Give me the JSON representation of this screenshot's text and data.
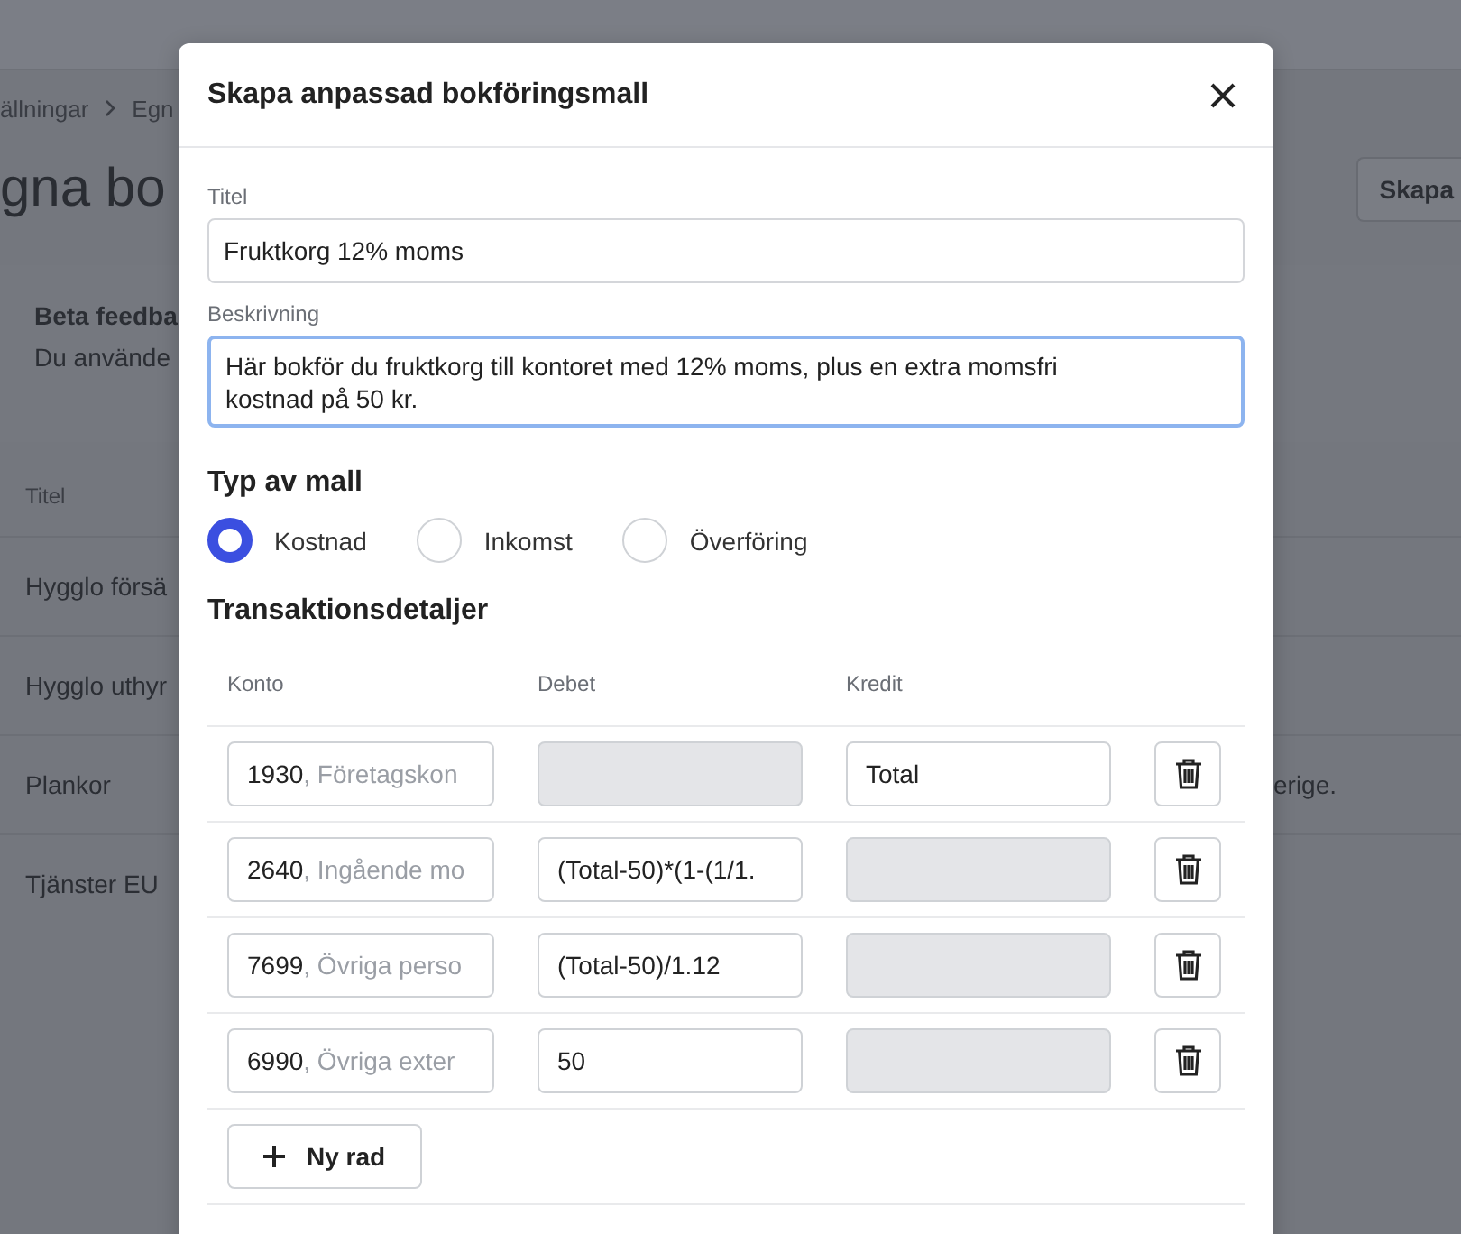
{
  "background_page": {
    "breadcrumb": [
      "ällningar",
      "Egn"
    ],
    "heading": "gna bo",
    "create_button": "Skapa",
    "beta_card": {
      "title": "Beta feedba",
      "text": "Du använde"
    },
    "table": {
      "columns": [
        "Titel"
      ],
      "rows": [
        {
          "cells": [
            "Hygglo försä"
          ]
        },
        {
          "cells": [
            "Hygglo uthyr"
          ]
        },
        {
          "cells": [
            "Plankor",
            "erige."
          ]
        },
        {
          "cells": [
            "Tjänster EU"
          ]
        }
      ]
    }
  },
  "dialog": {
    "title": "Skapa anpassad bokföringsmall",
    "fields": [
      {
        "label": "Titel",
        "value": "Fruktkorg 12% moms",
        "focused": false,
        "kind": "line"
      },
      {
        "label": "Beskrivning",
        "value": "Här bokför du fruktkorg till kontoret med 12% moms, plus en extra momsfri kostnad på 50 kr.",
        "focused": true,
        "kind": "area"
      }
    ],
    "type_heading": "Typ av mall",
    "types": [
      {
        "label": "Kostnad",
        "selected": true
      },
      {
        "label": "Inkomst",
        "selected": false
      },
      {
        "label": "Överföring",
        "selected": false
      }
    ],
    "transactions_heading": "Transaktionsdetaljer",
    "columns": [
      "Konto",
      "Debet",
      "Kredit"
    ],
    "rows": [
      {
        "account": {
          "code": "1930",
          "name": ", Företagskon"
        },
        "debit": {
          "disabled": true
        },
        "credit": {
          "value": "Total",
          "disabled": false
        }
      },
      {
        "account": {
          "code": "2640",
          "name": ", Ingående mo"
        },
        "debit": {
          "value": "(Total-50)*(1-(1/1.",
          "disabled": false
        },
        "credit": {
          "disabled": true
        }
      },
      {
        "account": {
          "code": "7699",
          "name": ", Övriga perso"
        },
        "debit": {
          "value": "(Total-50)/1.12",
          "disabled": false
        },
        "credit": {
          "disabled": true
        }
      },
      {
        "account": {
          "code": "6990",
          "name": ", Övriga exter"
        },
        "debit": {
          "value": "50",
          "disabled": false
        },
        "credit": {
          "disabled": true
        }
      }
    ],
    "add_row_button": "Ny rad"
  }
}
